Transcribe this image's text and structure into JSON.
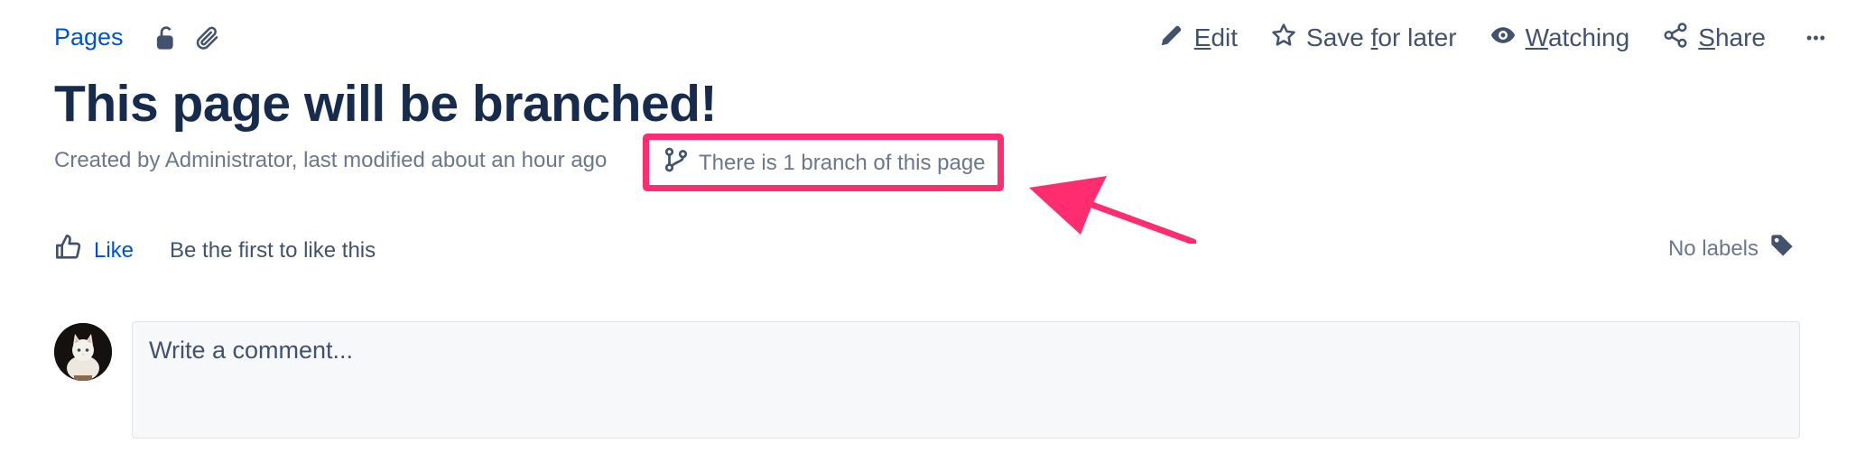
{
  "breadcrumb": {
    "pages_label": "Pages"
  },
  "page_meta_icons": [
    "unlocked-icon",
    "attachment-icon"
  ],
  "toolbar": {
    "edit": {
      "pre": "",
      "u": "E",
      "post": "dit"
    },
    "save_for_later": {
      "pre": "Save ",
      "u": "f",
      "post": "or later"
    },
    "watching": {
      "pre": "",
      "u": "W",
      "post": "atching"
    },
    "share": {
      "pre": "",
      "u": "S",
      "post": "hare"
    },
    "more": "•••"
  },
  "page": {
    "title": "This page will be branched!",
    "byline": "Created by Administrator, last modified about an hour ago",
    "branch_notice": "There is 1 branch of this page"
  },
  "annotation": {
    "highlight_color": "#ff2d6f"
  },
  "likes": {
    "like_label": "Like",
    "first_text": "Be the first to like this"
  },
  "labels": {
    "text": "No labels"
  },
  "comment": {
    "placeholder": "Write a comment..."
  },
  "colors": {
    "link": "#0052cc",
    "title": "#172b4d",
    "muted": "#6b778c",
    "toolbar": "#42526e"
  }
}
